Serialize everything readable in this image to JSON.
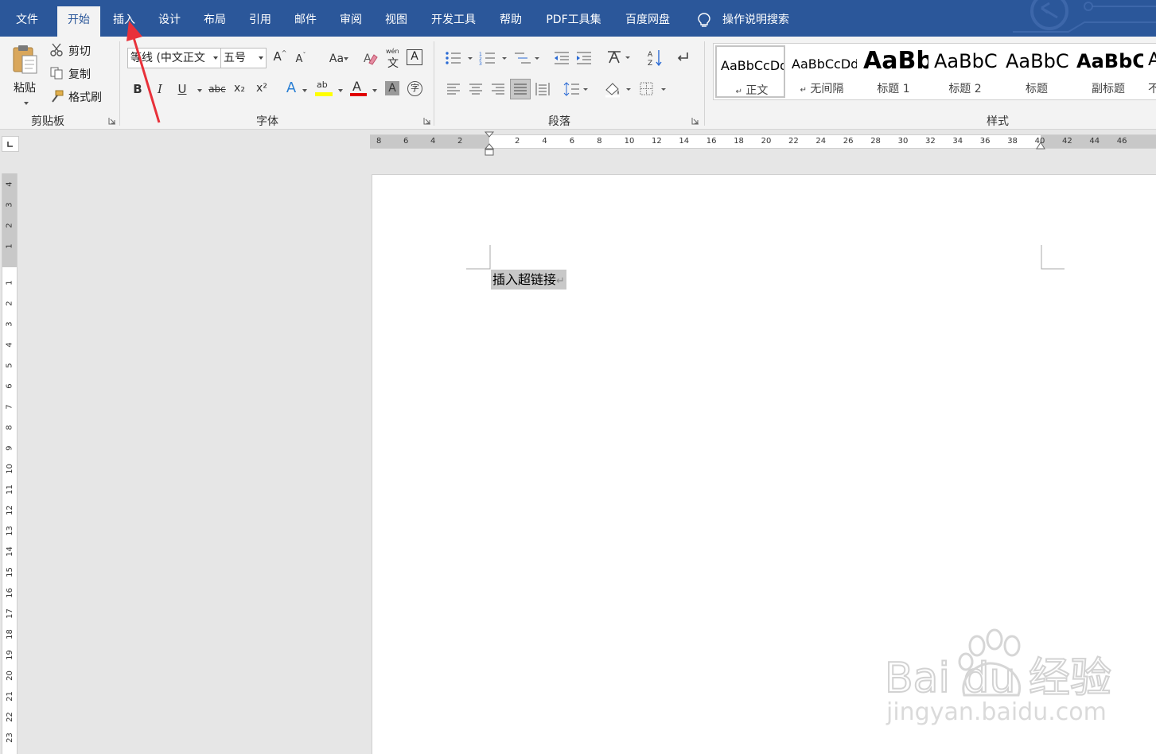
{
  "tabs": [
    {
      "label": "文件",
      "active": false
    },
    {
      "label": "开始",
      "active": true
    },
    {
      "label": "插入",
      "active": false
    },
    {
      "label": "设计",
      "active": false
    },
    {
      "label": "布局",
      "active": false
    },
    {
      "label": "引用",
      "active": false
    },
    {
      "label": "邮件",
      "active": false
    },
    {
      "label": "审阅",
      "active": false
    },
    {
      "label": "视图",
      "active": false
    },
    {
      "label": "开发工具",
      "active": false
    },
    {
      "label": "帮助",
      "active": false
    },
    {
      "label": "PDF工具集",
      "active": false
    },
    {
      "label": "百度网盘",
      "active": false
    }
  ],
  "tell_me": {
    "icon": "lightbulb-icon",
    "label": "操作说明搜索"
  },
  "clipboard": {
    "paste_label": "粘贴",
    "cut_label": "剪切",
    "copy_label": "复制",
    "format_painter_label": "格式刷",
    "group_label": "剪贴板"
  },
  "font": {
    "font_name": "等线 (中文正文",
    "font_size": "五号",
    "change_case_label": "Aa",
    "bold_label": "B",
    "italic_label": "I",
    "underline_label": "U",
    "strike_label": "abc",
    "subscript_label": "x₂",
    "superscript_label": "x²",
    "text_effects_label": "A",
    "highlight_label": "ab",
    "font_color_label": "A",
    "char_shading_label": "A",
    "enclose_label": "字",
    "phonetic_label": "wén",
    "phonetic_char": "文",
    "border_label": "A",
    "highlight_color": "#ffff00",
    "font_color": "#e00000",
    "group_label": "字体"
  },
  "paragraph": {
    "group_label": "段落"
  },
  "styles": {
    "group_label": "样式",
    "items": [
      {
        "sample": "AaBbCcDd",
        "name": "正文",
        "mark": "↵",
        "selected": true
      },
      {
        "sample": "AaBbCcDd",
        "name": "无间隔",
        "mark": "↵",
        "selected": false
      },
      {
        "sample": "AaBb",
        "name": "标题 1",
        "mark": "",
        "selected": false
      },
      {
        "sample": "AaBbC",
        "name": "标题 2",
        "mark": "",
        "selected": false
      },
      {
        "sample": "AaBbC",
        "name": "标题",
        "mark": "",
        "selected": false
      },
      {
        "sample": "AaBbC",
        "name": "副标题",
        "mark": "",
        "selected": false
      },
      {
        "sample": "A",
        "name": "不",
        "mark": "",
        "selected": false
      }
    ]
  },
  "ruler": {
    "left_numbers": [
      "8",
      "6",
      "4",
      "2"
    ],
    "right_numbers": [
      "2",
      "4",
      "6",
      "8",
      "10",
      "12",
      "14",
      "16",
      "18",
      "20",
      "22",
      "24",
      "26",
      "28",
      "30",
      "32",
      "34",
      "36",
      "38",
      "40",
      "42",
      "44",
      "46"
    ],
    "vertical_top_numbers": [
      "4",
      "3",
      "2",
      "1"
    ],
    "vertical_numbers": [
      "1",
      "2",
      "3",
      "4",
      "5",
      "6",
      "7",
      "8",
      "9",
      "10",
      "11",
      "12",
      "13",
      "14",
      "15",
      "16",
      "17",
      "18",
      "19",
      "20",
      "21",
      "22",
      "23"
    ]
  },
  "document": {
    "text": "插入超链接",
    "paragraph_mark": "↵"
  },
  "watermark": {
    "brand": "Bai du 经验",
    "url": "jingyan.baidu.com"
  },
  "annotation": {
    "color": "#e8313a",
    "icon": "red-arrow-pointer"
  },
  "colors": {
    "ribbon_blue": "#2b579a",
    "ribbon_bg": "#f3f3f3",
    "selection": "#c8c8c8"
  }
}
